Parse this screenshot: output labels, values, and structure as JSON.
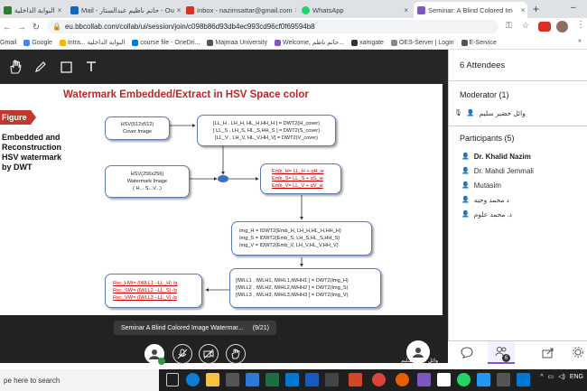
{
  "browser": {
    "tabs": [
      {
        "label": "البوابة الداخلية",
        "color": "#2e7d32"
      },
      {
        "label": "Mail - حاتم ناظيم عبدالستار - Ou",
        "color": "#1565c0"
      },
      {
        "label": "Inbox - nazimsattar@gmail.com",
        "color": "#d93025"
      },
      {
        "label": "WhatsApp",
        "color": "#25d366"
      },
      {
        "label": "Seminar: A Blind Colored Im",
        "color": "#7e57c2"
      }
    ],
    "new_tab": "+",
    "url": "eu.bbcollab.com/collab/ui/session/join/c098b86d93db4ec993cd96cf0f69594b8",
    "bookmarks": [
      {
        "label": "Gmail",
        "color": "#d93025"
      },
      {
        "label": "Google",
        "color": "#4285f4"
      },
      {
        "label": "Intra... البوابة الداخلية",
        "color": "#f4b400"
      },
      {
        "label": "course file - OneDri...",
        "color": "#0078d4"
      },
      {
        "label": "Majmaa University",
        "color": "#555555"
      },
      {
        "label": "Welcome, حاتم ناظم...",
        "color": "#7e57c2"
      },
      {
        "label": "xamgate",
        "color": "#333333"
      },
      {
        "label": "OES-Server | Login",
        "color": "#888888"
      },
      {
        "label": "E-Service",
        "color": "#555555"
      }
    ],
    "more": "»"
  },
  "slide": {
    "title": "Watermark Embedded/Extract in HSV Space color",
    "figure_label": "Figure",
    "caption": "Embedded and Reconstruction HSV watermark by DWT",
    "cover": [
      "HSV(512x512)",
      "Cover Image"
    ],
    "dwt_lines": [
      "[LL_H , LH_H, HL_H,HH_H ] = DWT2(H_cover)",
      "[ LL_S , LH_S, HL_S,HH_S ] = DWT2(S_cover)",
      "[LL_V , LH_V, HL_V,HH_V] = DWT2(V_cover)"
    ],
    "watermark": [
      "HSV(256x256)",
      "Watermark Image",
      "( H... S...V...)"
    ],
    "emb_lines": [
      "Emb_H= LL_H + αH_w",
      "Emb_S= LL_S + αS_w",
      "Emb_V= LL_V + αV_w"
    ],
    "idwt_lines": [
      "Img_H = IDWT2(Emb_H, LH_H,HL_H,HH_H)",
      "Img_S = IDWT2(Emb_S, LH_S,HL_S,HH_S)",
      "Img_V = IDWT2(Emb_V, LH_V,HL_V,HH_V)"
    ],
    "dwt2_lines": [
      "[IWLL1 , IWLH1, IWHL1,IWHH1 ] = DWT2(Img_H)",
      "[IWLL2 , IWLH2, IWHL2,IWHH2 ] = DWT2(Img_S)",
      "[IWLL3 , IWLH3, IWHL3,IWHH3 ] = DWT2(Img_V)"
    ],
    "rec_lines": [
      "Rec_HW= (IWLL1 –LL_H) /α",
      "Rec_SW= (IWLL2 –LL_S) /α",
      "Rec_VW= (IWLL3 –LL_V) /α"
    ]
  },
  "session": {
    "slide_name": "Seminar A Blind Colored Image Watermar...",
    "slide_page": "(9/21)",
    "presenter_name": "وائل خضير سليم"
  },
  "panel": {
    "header": "6 Attendees",
    "moderator_header": "Moderator (1)",
    "moderators": [
      "وائل خضير سليم"
    ],
    "participants_header": "Participants (5)",
    "participants": [
      "Dr. Khalid Nazim",
      "Dr. Mahdi Jemmali",
      "Mutasim",
      "د محمد وجيه",
      "د. محمد علوم"
    ],
    "badge": "6"
  },
  "taskbar": {
    "search_placeholder": "pe here to search",
    "lang": "ENG"
  }
}
